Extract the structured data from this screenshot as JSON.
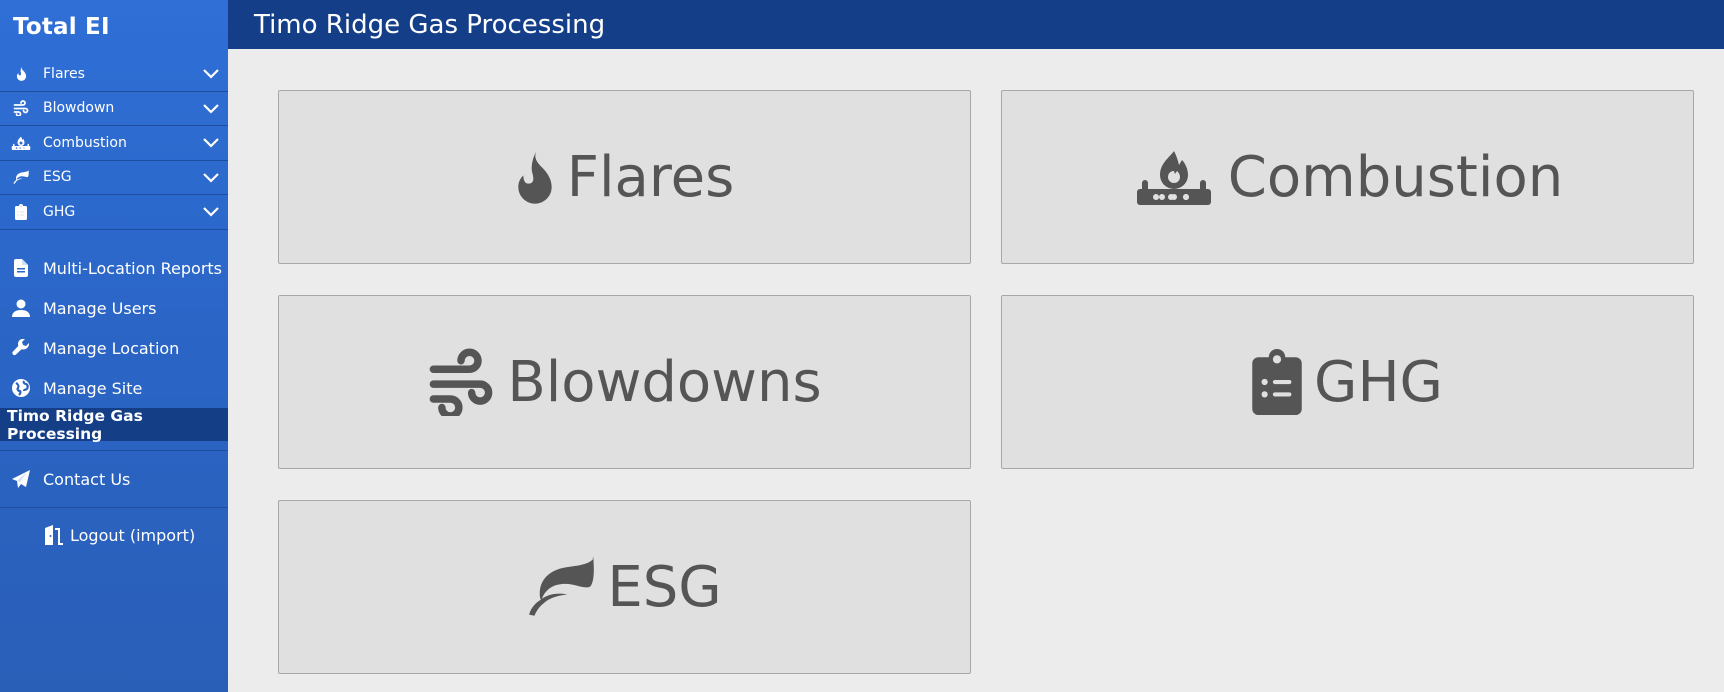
{
  "sidebar": {
    "brand": "Total EI",
    "accordion": [
      {
        "label": "Flares",
        "icon": "fire-icon"
      },
      {
        "label": "Blowdown",
        "icon": "wind-icon"
      },
      {
        "label": "Combustion",
        "icon": "burner-icon"
      },
      {
        "label": "ESG",
        "icon": "leaf-icon"
      },
      {
        "label": "GHG",
        "icon": "clipboard-list-icon"
      }
    ],
    "nav": [
      {
        "label": "Multi-Location Reports",
        "icon": "file-icon"
      },
      {
        "label": "Manage Users",
        "icon": "user-icon"
      },
      {
        "label": "Manage Location",
        "icon": "wrench-icon"
      },
      {
        "label": "Manage Site",
        "icon": "globe-icon"
      }
    ],
    "active_location": "Timo Ridge Gas Processing",
    "contact": {
      "label": "Contact Us",
      "icon": "paper-plane-icon"
    },
    "logout": {
      "label": "Logout (import)",
      "icon": "door-open-icon"
    }
  },
  "header": {
    "title": "Timo Ridge Gas Processing"
  },
  "cards": [
    {
      "label": "Flares",
      "icon": "fire-icon"
    },
    {
      "label": "Combustion",
      "icon": "burner-icon"
    },
    {
      "label": "Blowdowns",
      "icon": "wind-icon"
    },
    {
      "label": "GHG",
      "icon": "clipboard-list-icon"
    },
    {
      "label": "ESG",
      "icon": "leaf-icon"
    }
  ],
  "colors": {
    "sidebar": "#2f6fd6",
    "header": "#143f88",
    "active": "#143f86",
    "card_bg": "#e0e0e0",
    "card_text": "#555555",
    "page_bg": "#ececec"
  }
}
